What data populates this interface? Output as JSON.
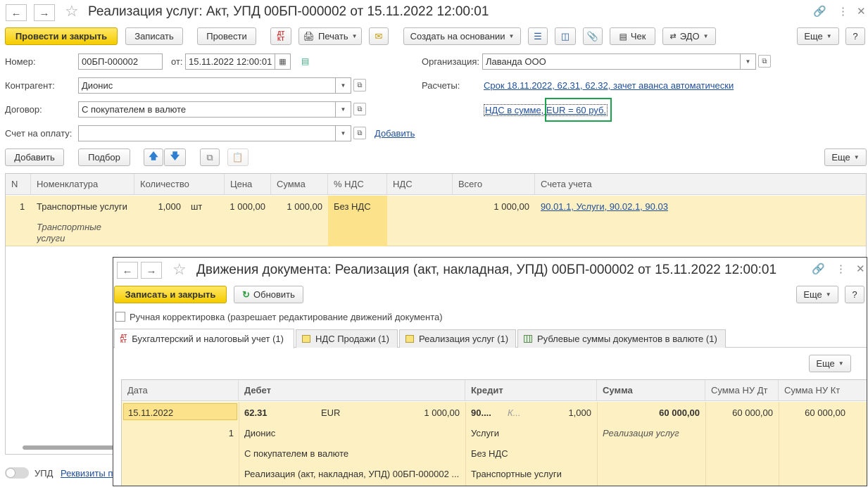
{
  "doc": {
    "title": "Реализация услуг: Акт, УПД 00БП-000002 от 15.11.2022 12:00:01",
    "toolbar": {
      "post_close": "Провести и закрыть",
      "write": "Записать",
      "post": "Провести",
      "print": "Печать",
      "create_based": "Создать на основании",
      "check": "Чек",
      "edo": "ЭДО",
      "more": "Еще",
      "help": "?"
    },
    "fields": {
      "number_label": "Номер:",
      "number": "00БП-000002",
      "date_label": "от:",
      "date": "15.11.2022 12:00:01",
      "org_label": "Организация:",
      "org": "Лаванда ООО",
      "counterparty_label": "Контрагент:",
      "counterparty": "Дионис",
      "settlements_label": "Расчеты:",
      "settlements_link": "Срок 18.11.2022, 62.31, 62.32, зачет аванса автоматически",
      "contract_label": "Договор:",
      "contract": "С покупателем в валюте",
      "vat_link": "НДС в сумме, EUR = 60 руб.",
      "invoice_label": "Счет на оплату:",
      "invoice": "",
      "add_link": "Добавить"
    },
    "table_toolbar": {
      "add": "Добавить",
      "pick": "Подбор",
      "more": "Еще"
    },
    "table": {
      "headers": [
        "N",
        "Номенклатура",
        "Количество",
        "Цена",
        "Сумма",
        "% НДС",
        "НДС",
        "Всего",
        "Счета учета"
      ],
      "row": {
        "n": "1",
        "item": "Транспортные услуги",
        "item_sub": "Транспортные услуги",
        "qty": "1,000",
        "unit": "шт",
        "price": "1 000,00",
        "sum": "1 000,00",
        "vat_rate": "Без НДС",
        "vat": "",
        "total": "1 000,00",
        "accounts": "90.01.1, Услуги, 90.02.1, 90.03"
      }
    },
    "footer": {
      "upd_label": "УПД",
      "requisites_link": "Реквизиты п"
    }
  },
  "moves": {
    "title": "Движения документа: Реализация (акт, накладная, УПД) 00БП-000002 от 15.11.2022 12:00:01",
    "toolbar": {
      "write_close": "Записать и закрыть",
      "refresh": "Обновить",
      "more": "Еще",
      "help": "?"
    },
    "manual_checkbox": "Ручная корректировка (разрешает редактирование движений документа)",
    "tabs": [
      "Бухгалтерский и налоговый учет (1)",
      "НДС Продажи (1)",
      "Реализация услуг (1)",
      "Рублевые суммы документов в валюте (1)"
    ],
    "grid_more": "Еще",
    "headers": [
      "Дата",
      "Дебет",
      "Кредит",
      "Сумма",
      "Сумма НУ Дт",
      "Сумма НУ Кт"
    ],
    "row": {
      "date": "15.11.2022",
      "num": "1",
      "debit_account": "62.31",
      "debit_currency": "EUR",
      "debit_amount": "1 000,00",
      "debit_sub1": "Дионис",
      "debit_sub2": "С покупателем в валюте",
      "debit_sub3": "Реализация (акт, накладная, УПД) 00БП-000002 ...",
      "credit_account": "90....",
      "credit_k": "К...",
      "credit_qty": "1,000",
      "credit_sub1": "Услуги",
      "credit_sub2": "Без НДС",
      "credit_sub3": "Транспортные услуги",
      "sum": "60 000,00",
      "content": "Реализация услуг",
      "sum_nu_dt": "60 000,00",
      "sum_nu_kt": "60 000,00"
    }
  },
  "colors": {
    "accent_yellow": "#f5cc00",
    "row_highlight": "#fdf0c2",
    "link_blue": "#1f4e9a",
    "frame_green": "#1aa34a"
  }
}
